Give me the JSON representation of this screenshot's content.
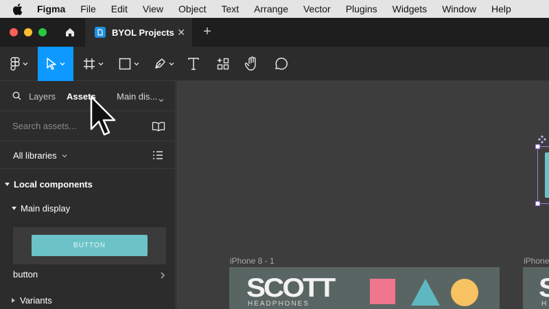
{
  "menubar": {
    "app": "Figma",
    "items": [
      "File",
      "Edit",
      "View",
      "Object",
      "Text",
      "Arrange",
      "Vector",
      "Plugins",
      "Widgets",
      "Window",
      "Help"
    ]
  },
  "tabs": [
    {
      "label": "BYOL Projects",
      "active": true
    }
  ],
  "toolbar": {
    "tools": [
      "main-menu",
      "move",
      "frame",
      "shape",
      "pen",
      "text",
      "resources",
      "hand",
      "comment"
    ],
    "active_tool": "move"
  },
  "panel": {
    "tabs": {
      "layers": "Layers",
      "assets": "Assets",
      "page": "Main dis..."
    },
    "search_placeholder": "Search assets...",
    "library_label": "All libraries",
    "section_local": "Local components",
    "section_main": "Main display",
    "component_button_text": "BUTTON",
    "component_name": "button",
    "section_variants": "Variants"
  },
  "canvas": {
    "frame1_label": "iPhone 8 - 1",
    "frame2_label": "iPhone",
    "logo_main": "SCOTT",
    "logo_sub": "HEADPHONES",
    "logo_peek": "S",
    "logo_sub_peek": "H"
  },
  "colors": {
    "accent": "#0d99ff",
    "component_button": "#6bc3c8",
    "shape_square": "#f0768e",
    "shape_triangle": "#5fb8c0",
    "shape_circle": "#f7c261",
    "selection": "#9f7ce6"
  }
}
